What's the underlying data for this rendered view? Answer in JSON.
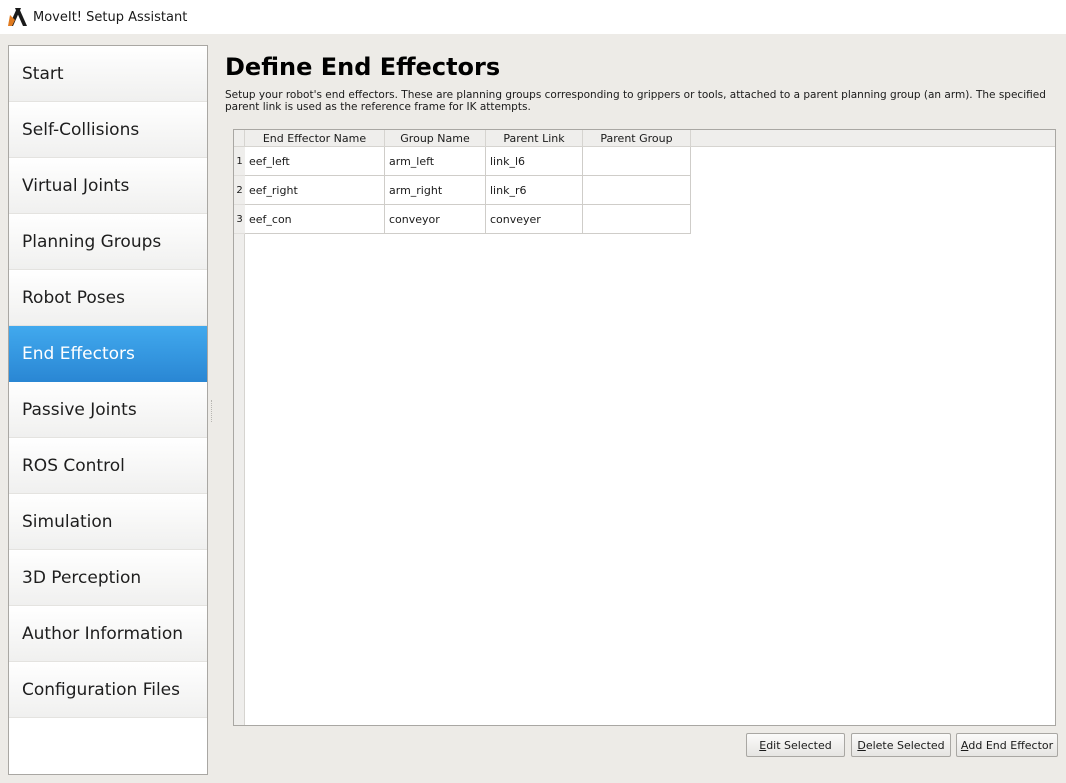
{
  "window": {
    "title": "MoveIt! Setup Assistant",
    "icon": "moveit-logo-icon"
  },
  "sidebar": {
    "active": "End Effectors",
    "items": [
      {
        "label": "Start"
      },
      {
        "label": "Self-Collisions"
      },
      {
        "label": "Virtual Joints"
      },
      {
        "label": "Planning Groups"
      },
      {
        "label": "Robot Poses"
      },
      {
        "label": "End Effectors"
      },
      {
        "label": "Passive Joints"
      },
      {
        "label": "ROS Control"
      },
      {
        "label": "Simulation"
      },
      {
        "label": "3D Perception"
      },
      {
        "label": "Author Information"
      },
      {
        "label": "Configuration Files"
      }
    ]
  },
  "main": {
    "title": "Define End Effectors",
    "description": "Setup your robot's end effectors. These are planning groups corresponding to grippers or tools, attached to a parent planning group (an arm). The specified parent link is used as the reference frame for IK attempts.",
    "table": {
      "columns": [
        "End Effector Name",
        "Group Name",
        "Parent Link",
        "Parent Group"
      ],
      "rows": [
        {
          "num": "1",
          "cells": [
            "eef_left",
            "arm_left",
            "link_l6",
            ""
          ]
        },
        {
          "num": "2",
          "cells": [
            "eef_right",
            "arm_right",
            "link_r6",
            ""
          ]
        },
        {
          "num": "3",
          "cells": [
            "eef_con",
            "conveyor",
            "conveyer",
            ""
          ]
        }
      ]
    },
    "buttons": {
      "edit": {
        "mnemonic": "E",
        "rest": "dit Selected"
      },
      "delete": {
        "mnemonic": "D",
        "rest": "elete Selected"
      },
      "add": {
        "mnemonic": "A",
        "rest": "dd End Effector"
      }
    }
  },
  "colors": {
    "active_item": "#2f93e0",
    "window_bg": "#edebe7"
  }
}
